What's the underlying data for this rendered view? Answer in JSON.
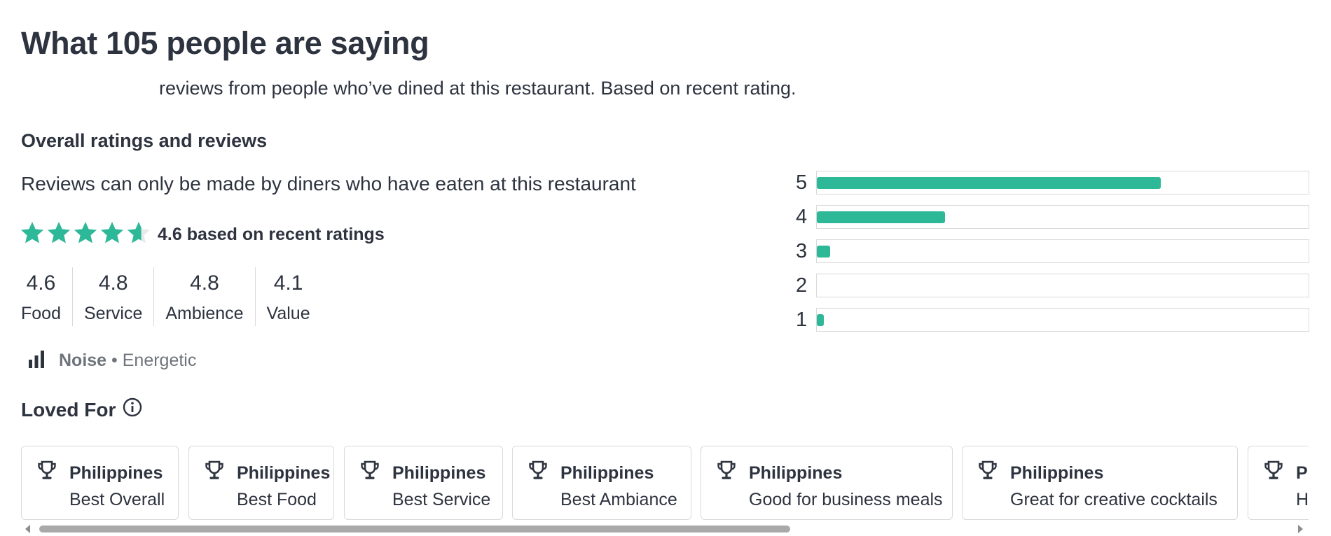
{
  "header": {
    "title": "What 105 people are saying",
    "subtitle": "reviews from people who’ve dined at this restaurant. Based on recent rating."
  },
  "overall": {
    "heading": "Overall ratings and reviews",
    "note": "Reviews can only be made by diners who have eaten at this restaurant",
    "stars_value": 4.6,
    "rating_text": "4.6 based on recent ratings",
    "star_color": "#2db897",
    "categories": [
      {
        "value": "4.6",
        "label": "Food"
      },
      {
        "value": "4.8",
        "label": "Service"
      },
      {
        "value": "4.8",
        "label": "Ambience"
      },
      {
        "value": "4.1",
        "label": "Value"
      }
    ]
  },
  "noise": {
    "icon": "noise-level-icon",
    "label": "Noise",
    "separator": " • ",
    "value": "Energetic"
  },
  "loved_for": {
    "heading": "Loved For",
    "info_icon": "info-icon",
    "cards": [
      {
        "location": "Philippines",
        "award": "Best Overall"
      },
      {
        "location": "Philippines",
        "award": "Best Food"
      },
      {
        "location": "Philippines",
        "award": "Best Service"
      },
      {
        "location": "Philippines",
        "award": "Best Ambiance"
      },
      {
        "location": "Philippines",
        "award": "Good for business meals"
      },
      {
        "location": "Philippines",
        "award": "Great for creative cocktails"
      },
      {
        "location": "Ph",
        "award": "H"
      }
    ]
  },
  "distribution": {
    "bar_color": "#2db897",
    "rows": [
      {
        "stars": "5",
        "fraction": 0.7
      },
      {
        "stars": "4",
        "fraction": 0.26
      },
      {
        "stars": "3",
        "fraction": 0.027
      },
      {
        "stars": "2",
        "fraction": 0.0
      },
      {
        "stars": "1",
        "fraction": 0.014
      }
    ]
  }
}
